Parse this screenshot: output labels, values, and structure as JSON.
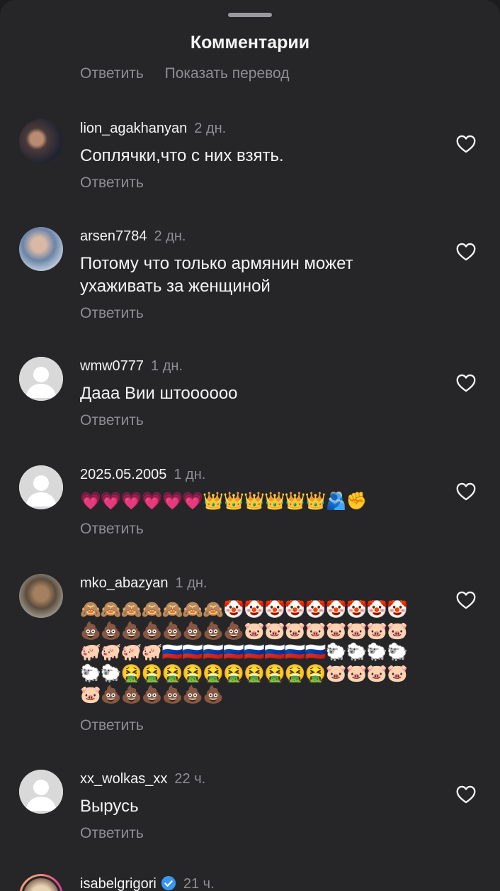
{
  "header": {
    "title": "Комментарии"
  },
  "previous": {
    "reply_label": "Ответить",
    "translate_label": "Показать перевод"
  },
  "comments": [
    {
      "username": "lion_agakhanyan",
      "time": "2 дн.",
      "text": "Соплячки,что с них взять.",
      "reply": "Ответить",
      "avatar": "photo"
    },
    {
      "username": "arsen7784",
      "time": "2 дн.",
      "text": "Потому что только армянин может ухаживать за женщиной",
      "reply": "Ответить",
      "avatar": "photo"
    },
    {
      "username": "wmw0777",
      "time": "1 дн.",
      "text": "Дааа Вии штоооооо",
      "reply": "Ответить",
      "avatar": "default"
    },
    {
      "username": "2025.05.2005",
      "time": "1 дн.",
      "text": "💗💗💗💗💗💗👑👑👑👑👑👑🫂✊",
      "reply": "Ответить",
      "avatar": "default"
    },
    {
      "username": "mko_abazyan",
      "time": "1 дн.",
      "text": "🙈🙈🙈🙈🙈🙈🙈🤡🤡🤡🤡🤡🤡🤡🤡🤡💩💩💩💩💩💩💩💩🐷🐷🐷🐷🐷🐷🐷🐷🐖🐖🐖🐖🇷🇺🇷🇺🇷🇺🇷🇺🇷🇺🇷🇺🇷🇺🇷🇺🐑🐑🐑🐑🐑🐑🤮🤮🤮🤮🤮🤮🤮🤮🤮🤮🐷🐷🐷🐷🐷💩💩💩💩💩💩",
      "reply": "Ответить",
      "avatar": "photo"
    },
    {
      "username": "xx_wolkas_xx",
      "time": "22 ч.",
      "text": "Вырусь",
      "reply": "Ответить",
      "avatar": "default"
    },
    {
      "username": "isabelgrigori",
      "time": "21 ч.",
      "text": "",
      "reply": "",
      "avatar": "story",
      "verified": true
    }
  ],
  "icons": {
    "like": "heart-outline-icon",
    "verified": "verified-badge-icon",
    "default_avatar": "default-avatar-icon"
  },
  "colors": {
    "background": "#262629",
    "text": "#f5f5f5",
    "secondary": "#8e8e93",
    "verified": "#3897f0"
  }
}
